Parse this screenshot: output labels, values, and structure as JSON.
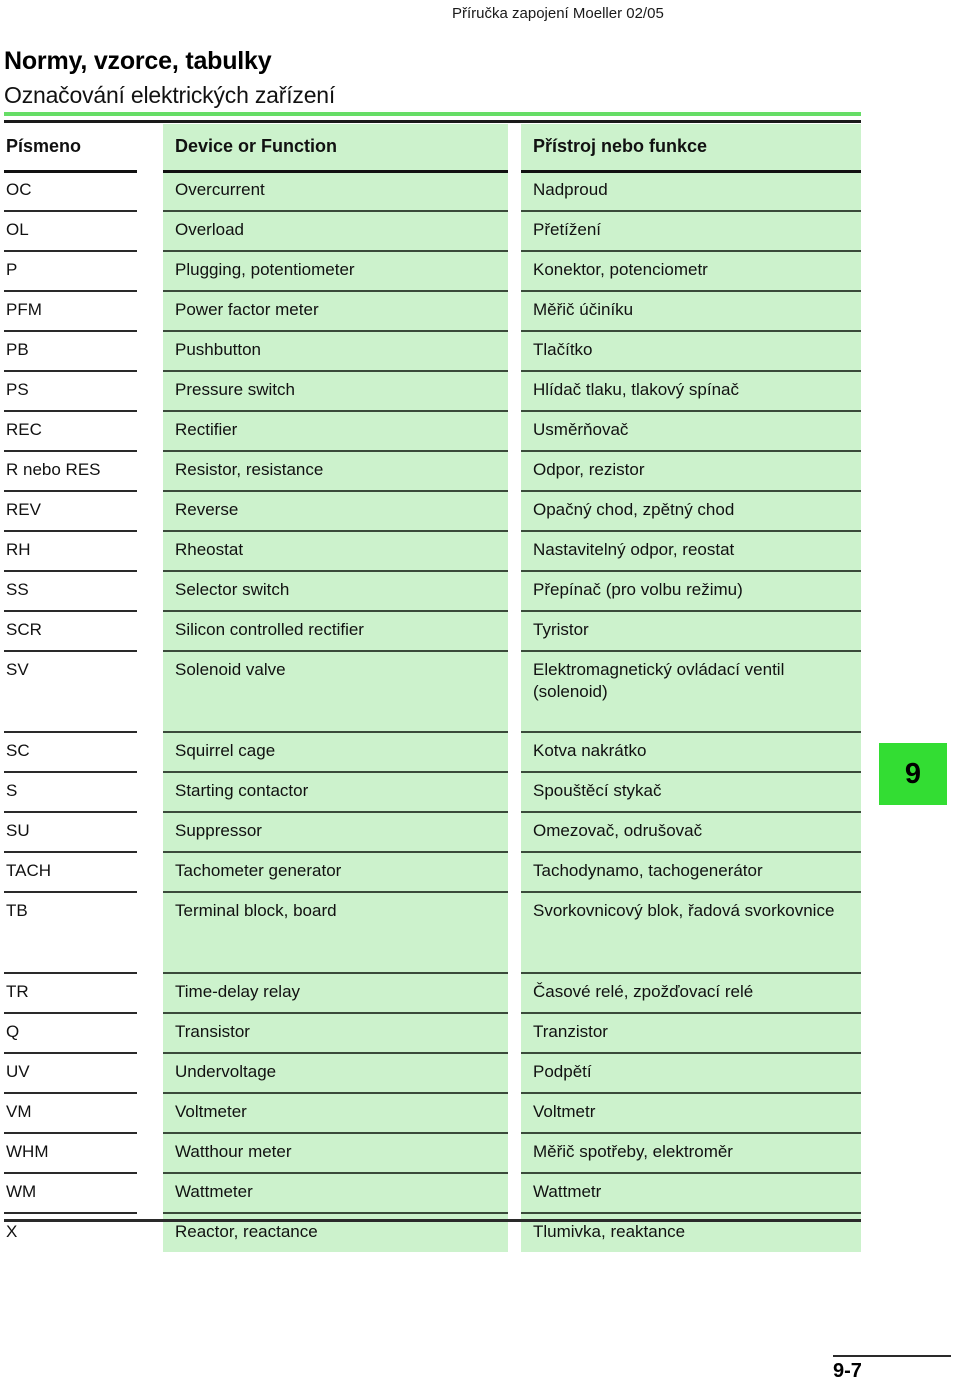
{
  "running_head": "Příručka zapojení Moeller 02/05",
  "page_title": "Normy, vzorce, tabulky",
  "page_subtitle": "Označování elektrických zařízení",
  "chapter_tab": "9",
  "folio": "9-7",
  "colors": {
    "cell_green": "#CCF2CC",
    "rule_green": "#66DD66",
    "tab_green": "#33DD33",
    "rule_black": "#1A1A1A"
  },
  "table": {
    "columns": [
      "Písmeno",
      "Device or Function",
      "Přístroj nebo funkce"
    ],
    "rows": [
      {
        "letter": "OC",
        "en": "Overcurrent",
        "cs": "Nadproud",
        "tall": false
      },
      {
        "letter": "OL",
        "en": "Overload",
        "cs": "Přetížení",
        "tall": false
      },
      {
        "letter": "P",
        "en": "Plugging, potentiometer",
        "cs": "Konektor, potenciometr",
        "tall": false
      },
      {
        "letter": "PFM",
        "en": "Power factor meter",
        "cs": "Měřič účiníku",
        "tall": false
      },
      {
        "letter": "PB",
        "en": "Pushbutton",
        "cs": "Tlačítko",
        "tall": false
      },
      {
        "letter": "PS",
        "en": "Pressure switch",
        "cs": "Hlídač tlaku, tlakový spínač",
        "tall": false
      },
      {
        "letter": "REC",
        "en": "Rectifier",
        "cs": "Usměrňovač",
        "tall": false
      },
      {
        "letter": "R nebo RES",
        "en": "Resistor, resistance",
        "cs": "Odpor, rezistor",
        "tall": false
      },
      {
        "letter": "REV",
        "en": "Reverse",
        "cs": "Opačný chod, zpětný chod",
        "tall": false
      },
      {
        "letter": "RH",
        "en": "Rheostat",
        "cs": "Nastavitelný odpor, reostat",
        "tall": false
      },
      {
        "letter": "SS",
        "en": "Selector switch",
        "cs": "Přepínač (pro volbu režimu)",
        "tall": false
      },
      {
        "letter": "SCR",
        "en": "Silicon controlled rectifier",
        "cs": "Tyristor",
        "tall": false
      },
      {
        "letter": "SV",
        "en": "Solenoid valve",
        "cs": "Elektromagnetický ovládací ventil (solenoid)",
        "tall": true
      },
      {
        "letter": "SC",
        "en": "Squirrel cage",
        "cs": "Kotva nakrátko",
        "tall": false
      },
      {
        "letter": "S",
        "en": "Starting contactor",
        "cs": "Spouštěcí stykač",
        "tall": false
      },
      {
        "letter": "SU",
        "en": "Suppressor",
        "cs": "Omezovač, odrušovač",
        "tall": false
      },
      {
        "letter": "TACH",
        "en": "Tachometer generator",
        "cs": "Tachodynamo, tachogenerátor",
        "tall": false
      },
      {
        "letter": "TB",
        "en": "Terminal block, board",
        "cs": "Svorkovnicový blok, řadová svorkovnice",
        "tall": true
      },
      {
        "letter": "TR",
        "en": "Time-delay relay",
        "cs": "Časové relé, zpožďovací relé",
        "tall": false
      },
      {
        "letter": "Q",
        "en": "Transistor",
        "cs": "Tranzistor",
        "tall": false
      },
      {
        "letter": "UV",
        "en": "Undervoltage",
        "cs": "Podpětí",
        "tall": false
      },
      {
        "letter": "VM",
        "en": "Voltmeter",
        "cs": "Voltmetr",
        "tall": false
      },
      {
        "letter": "WHM",
        "en": "Watthour meter",
        "cs": "Měřič spotřeby, elektroměr",
        "tall": false
      },
      {
        "letter": "WM",
        "en": "Wattmeter",
        "cs": "Wattmetr",
        "tall": false
      },
      {
        "letter": "X",
        "en": "Reactor, reactance",
        "cs": "Tlumivka, reaktance",
        "tall": false
      }
    ]
  }
}
